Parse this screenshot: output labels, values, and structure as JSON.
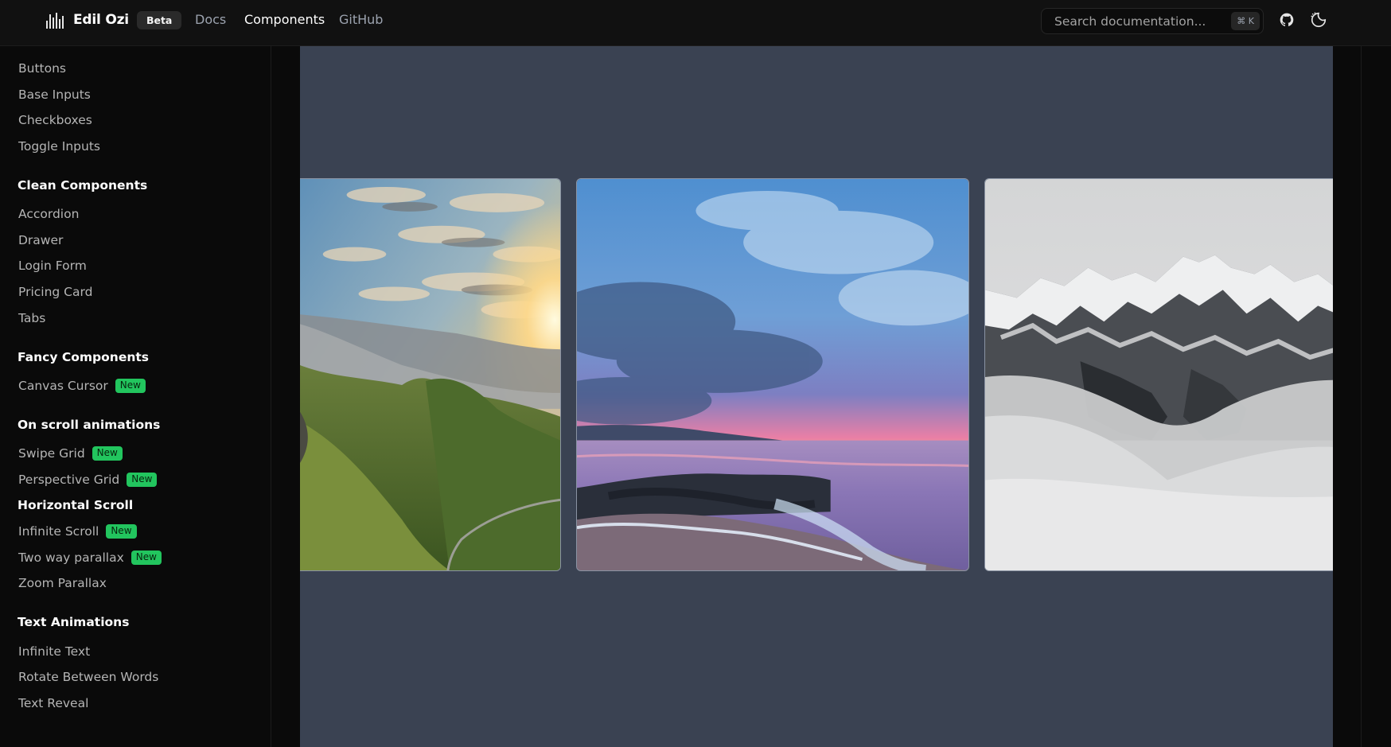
{
  "header": {
    "brand": "Edil Ozi",
    "badge": "Beta",
    "nav": [
      {
        "label": "Docs"
      },
      {
        "label": "Components"
      },
      {
        "label": "GitHub"
      }
    ],
    "search": {
      "placeholder": "Search documentation...",
      "shortcut": "⌘ K"
    },
    "icons": [
      "github-icon",
      "theme-toggle-icon"
    ]
  },
  "sidebar": {
    "items_top": [
      "Buttons",
      "Base Inputs",
      "Checkboxes",
      "Toggle Inputs"
    ],
    "sections": [
      {
        "title": "Clean Components",
        "items": [
          "Accordion",
          "Drawer",
          "Login Form",
          "Pricing Card",
          "Tabs"
        ]
      },
      {
        "title": "Fancy Components",
        "items": [
          "Canvas Cursor"
        ]
      },
      {
        "title": "On scroll animations",
        "items": [
          "Swipe Grid",
          "Perspective Grid",
          "Horizontal Scroll",
          "Infinite Scroll",
          "Two way parallax",
          "Zoom Parallax"
        ]
      },
      {
        "title": "Text Animations",
        "items": [
          "Infinite Text",
          "Rotate Between Words",
          "Text Reveal"
        ]
      }
    ],
    "new_badge": "New",
    "active_item": "Horizontal Scroll"
  },
  "gallery": {
    "images": [
      "mountain-valley-sunset",
      "ocean-shore-sunset",
      "snowy-mountain-clouds"
    ]
  },
  "colors": {
    "accent_new": "#22c55e",
    "stage_bg": "#3a4252",
    "app_bg": "#0a0a0a"
  }
}
